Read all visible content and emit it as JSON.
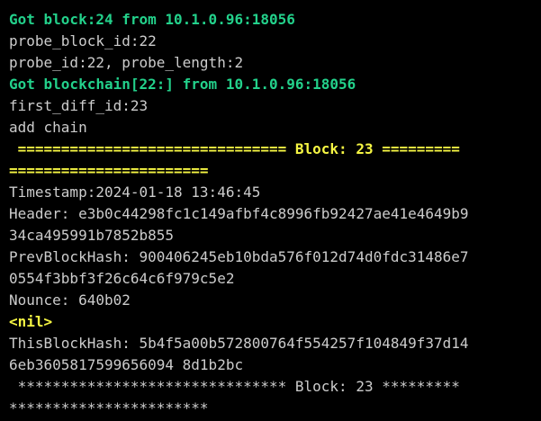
{
  "terminal": {
    "colors": {
      "background": "#000000",
      "text": "#cccccc",
      "highlight_green": "#23d18b",
      "highlight_yellow": "#f5f543"
    },
    "lines": [
      "Got block:24 from 10.1.0.96:18056",
      "probe_block_id:22",
      "probe_id:22, probe_length:2",
      "Got blockchain[22:] from 10.1.0.96:18056",
      "first_diff_id:23",
      "add chain",
      " =============================== Block: 23 =========",
      "=======================",
      "Timestamp:2024-01-18 13:46:45",
      "Header: e3b0c44298fc1c149afbf4c8996fb92427ae41e4649b9",
      "34ca495991b7852b855",
      "PrevBlockHash: 900406245eb10bda576f012d74d0fdc31486e7",
      "0554f3bbf3f26c64c6f979c5e2",
      "Nounce: 640b02",
      "<nil>",
      "ThisBlockHash: 5b4f5a00b572800764f554257f104849f37d14",
      "6eb3605817599656094 8d1b2bc",
      " ******************************* Block: 23 *********",
      "***********************"
    ]
  }
}
